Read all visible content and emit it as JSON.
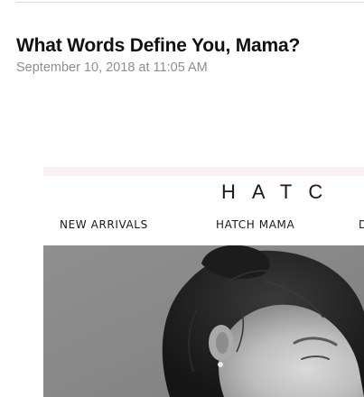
{
  "post": {
    "title": "What Words Define You, Mama?",
    "date": "September 10, 2018 at 11:05 AM"
  },
  "newsletter": {
    "logo_text": "HATC",
    "nav": [
      "NEW ARRIVALS",
      "HATCH MAMA",
      "D"
    ],
    "hero_image": "black-and-white photo of woman's face in profile"
  },
  "colors": {
    "title": "#111111",
    "date": "#8e8e93",
    "band": "#f8f2f2"
  }
}
